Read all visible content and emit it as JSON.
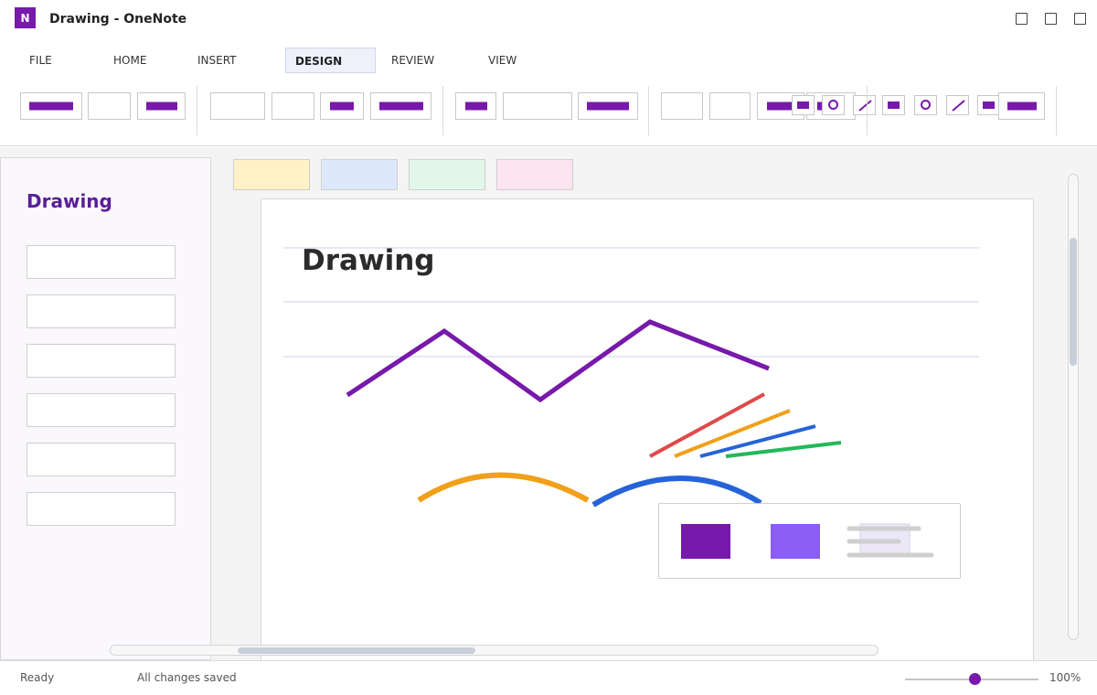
{
  "window": {
    "app_icon_letter": "N",
    "title": "Drawing - OneNote"
  },
  "ribbon": {
    "tabs": [
      {
        "label": "FILE",
        "active": false
      },
      {
        "label": "HOME",
        "active": false
      },
      {
        "label": "INSERT",
        "active": false
      },
      {
        "label": "DESIGN",
        "active": true
      },
      {
        "label": "REVIEW",
        "active": false
      },
      {
        "label": "VIEW",
        "active": false
      }
    ]
  },
  "navigation": {
    "section_title": "Drawing",
    "pages_count": 6
  },
  "section_tabs_colors": [
    "#fff2c6",
    "#dde9fb",
    "#e2f7ea",
    "#fce4f1"
  ],
  "page": {
    "title": "Drawing"
  },
  "ink": {
    "stroke_colors": {
      "purple": "#7719aa",
      "red": "#e04a4a",
      "orange": "#f0a01a",
      "blue": "#2563d8",
      "green": "#22b85a"
    }
  },
  "palette": {
    "swatch_colors": [
      "#7719aa",
      "#8b5cf6"
    ]
  },
  "status": {
    "left": "Ready",
    "saved": "All changes saved",
    "zoom": "100%",
    "zoom_level_percent": 100
  },
  "colors": {
    "accent": "#7719aa",
    "nav_title": "#5a1e96"
  }
}
